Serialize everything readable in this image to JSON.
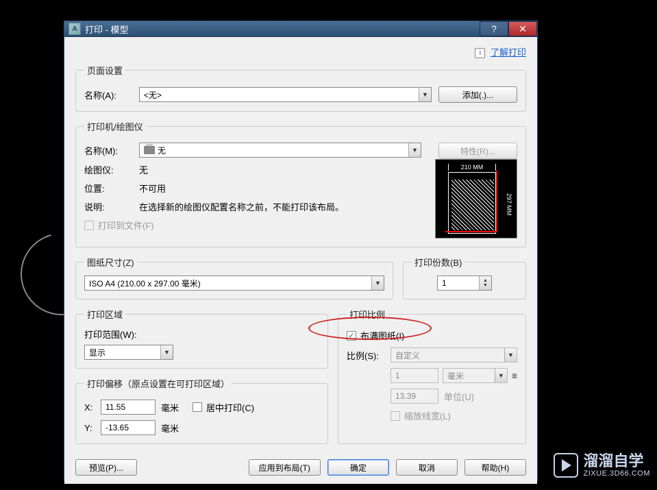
{
  "title": "打印 - 模型",
  "learn_link": "了解打印",
  "page_setup": {
    "legend": "页面设置",
    "name_label": "名称(A):",
    "name_value": "<无>",
    "add_btn": "添加(.)..."
  },
  "printer": {
    "legend": "打印机/绘图仪",
    "name_label": "名称(M):",
    "name_value": "无",
    "props_btn": "特性(R)...",
    "plotter_label": "绘图仪:",
    "plotter_value": "无",
    "location_label": "位置:",
    "location_value": "不可用",
    "desc_label": "说明:",
    "desc_value": "在选择新的绘图仪配置名称之前，不能打印该布局。",
    "to_file_label": "打印到文件(F)",
    "width_dim": "210 MM",
    "height_dim": "297 MM"
  },
  "paper": {
    "legend": "图纸尺寸(Z)",
    "value": "ISO A4 (210.00 x 297.00 毫米)"
  },
  "copies": {
    "legend": "打印份数(B)",
    "value": "1"
  },
  "area": {
    "legend": "打印区域",
    "scope_label": "打印范围(W):",
    "scope_value": "显示"
  },
  "offset": {
    "legend": "打印偏移（原点设置在可打印区域）",
    "x_label": "X:",
    "x_value": "11.55",
    "y_label": "Y:",
    "y_value": "-13.65",
    "unit": "毫米",
    "center_label": "居中打印(C)"
  },
  "scale": {
    "legend": "打印比例",
    "fit_label": "布满图纸(I)",
    "scale_label": "比例(S):",
    "scale_value": "自定义",
    "num_value": "1",
    "unit_value": "毫米",
    "denom_value": "13.39",
    "denom_unit": "单位(U)",
    "lineweight_label": "缩放线宽(L)"
  },
  "buttons": {
    "preview": "预览(P)...",
    "apply": "应用到布局(T)",
    "ok": "确定",
    "cancel": "取消",
    "help": "帮助(H)"
  },
  "watermark": {
    "main": "溜溜自学",
    "sub": "ZIXUE.3D66.COM"
  }
}
